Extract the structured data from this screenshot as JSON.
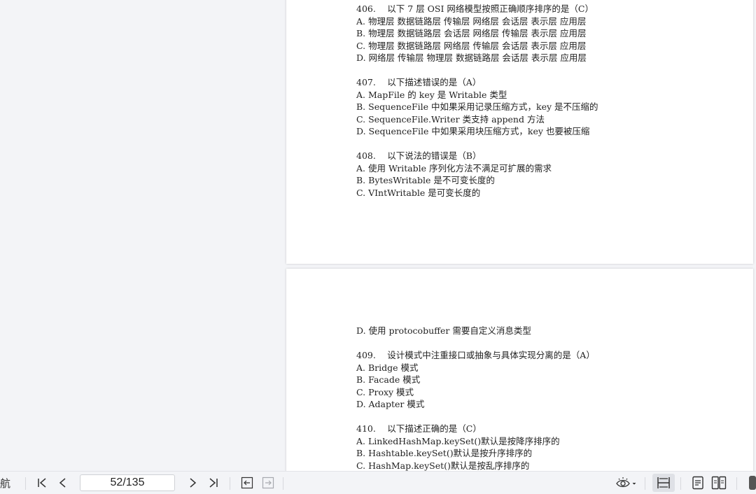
{
  "page1": {
    "lines": [
      "406.　 以下 7 层 OSI 网络模型按照正确顺序排序的是（C）",
      "A. 物理层 数据链路层 传输层 网络层 会话层 表示层 应用层",
      "B. 物理层 数据链路层 会话层 网络层 传输层 表示层 应用层",
      "C. 物理层 数据链路层 网络层 传输层 会话层 表示层 应用层",
      "D. 网络层 传输层 物理层 数据链路层 会话层 表示层 应用层",
      "",
      "407.　 以下描述错误的是（A）",
      "A. MapFile 的 key 是 Writable 类型",
      "B. SequenceFile 中如果采用记录压缩方式，key 是不压缩的",
      "C. SequenceFile.Writer 类支持 append 方法",
      "D. SequenceFile 中如果采用块压缩方式，key 也要被压缩",
      "",
      "408.　 以下说法的错误是（B）",
      "A. 使用 Writable 序列化方法不满足可扩展的需求",
      "B. BytesWritable 是不可变长度的",
      "C. VIntWritable 是可变长度的"
    ]
  },
  "page2": {
    "lines": [
      "D. 使用 protocobuffer 需要自定义消息类型",
      "",
      "409.　 设计模式中注重接口或抽象与具体实现分离的是（A）",
      "A. Bridge 模式",
      "B. Facade 模式",
      "C. Proxy 模式",
      "D. Adapter 模式",
      "",
      "410.　 以下描述正确的是（C）",
      "A. LinkedHashMap.keySet()默认是按降序排序的",
      "B. Hashtable.keySet()默认是按升序排序的",
      "C. HashMap.keySet()默认是按乱序排序的"
    ]
  },
  "toolbar": {
    "nav_label": "导航",
    "page_indicator": "52/135",
    "icons": [
      "first-page-icon",
      "prev-page-icon",
      "next-page-icon",
      "last-page-icon",
      "back-icon",
      "forward-icon",
      "eye-icon",
      "fit-width-icon",
      "single-page-icon",
      "two-page-icon"
    ]
  }
}
